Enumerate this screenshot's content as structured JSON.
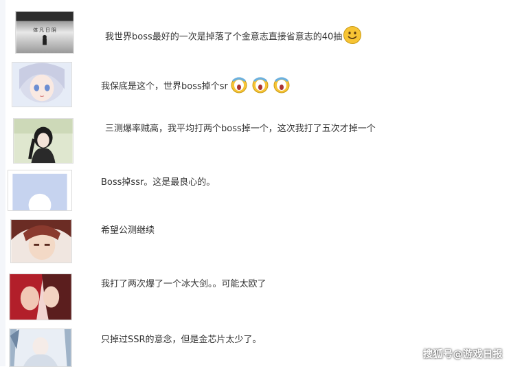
{
  "comments": [
    {
      "text": "我世界boss最好的一次是掉落了个金意志直接省意志的40抽",
      "avatar": "monochrome-scene-avatar",
      "avatar_caption": "体 凡 日 阴",
      "emoji": "smile-emoji"
    },
    {
      "text": "我保底是这个，世界boss掉个sr",
      "avatar": "anime-girl-avatar",
      "emoji": "crying-emoji"
    },
    {
      "text": "三测爆率贼高，我平均打两个boss掉一个，这次我打了五次才掉一个",
      "avatar": "black-hair-girl-avatar"
    },
    {
      "text": "Boss掉ssr。这是最良心的。",
      "avatar": "default-user-avatar"
    },
    {
      "text": "希望公测继续",
      "avatar": "red-hair-boy-avatar"
    },
    {
      "text": "我打了两次爆了一个冰大剑。。可能太欧了",
      "avatar": "couple-avatar"
    },
    {
      "text": "只掉过SSR的意念，但是金芯片太少了。",
      "avatar": "white-hair-girl-avatar"
    }
  ],
  "watermark": "搜狐号@游戏日报",
  "colors": {
    "text": "#333333",
    "background": "#ffffff",
    "avatar_border": "#dcdcdc",
    "emoji_yellow": "#f7c434"
  }
}
